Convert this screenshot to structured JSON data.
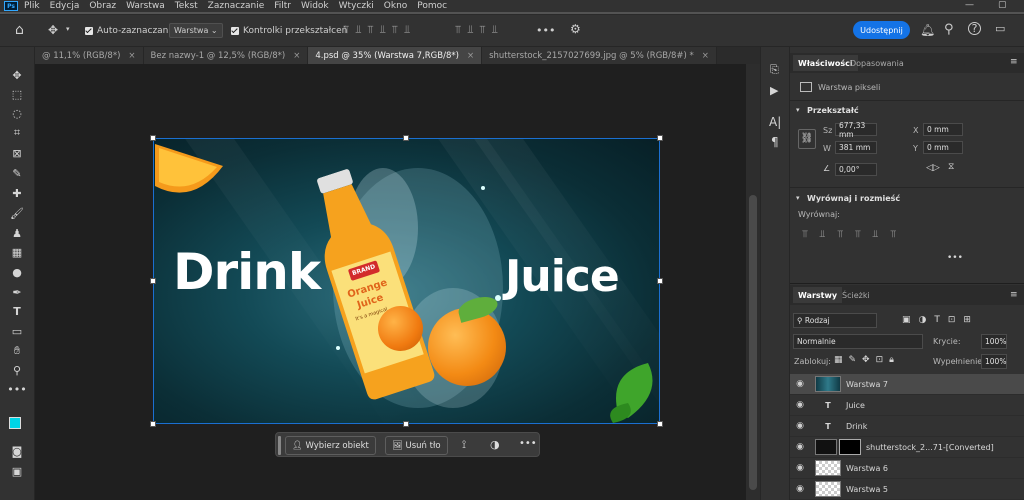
{
  "menubar": {
    "items": [
      "Plik",
      "Edycja",
      "Obraz",
      "Warstwa",
      "Tekst",
      "Zaznaczanie",
      "Filtr",
      "Widok",
      "Wtyczki",
      "Okno",
      "Pomoc"
    ]
  },
  "options": {
    "auto_select_label": "Auto-zaznaczanie:",
    "auto_select_value": "Warstwa",
    "transform_controls_label": "Kontrolki przekształceń",
    "share_label": "Udostępnij"
  },
  "tabs": [
    {
      "label": "@ 11,1% (RGB/8*)"
    },
    {
      "label": "Bez nazwy-1 @ 12,5% (RGB/8*)"
    },
    {
      "label": "4.psd @ 35% (Warstwa 7,RGB/8*)"
    },
    {
      "label": "shutterstock_2157027699.jpg @ 5% (RGB/8#) *"
    }
  ],
  "artwork": {
    "left_text": "Drink",
    "right_text": "Juice",
    "brand_label": "BRAND",
    "product_line1": "Orange",
    "product_line2": "Juice",
    "tagline": "It's a magical"
  },
  "context_bar": {
    "select_subject": "Wybierz obiekt",
    "remove_bg": "Usuń tło"
  },
  "properties": {
    "tab_properties": "Właściwości",
    "tab_adjustments": "Dopasowania",
    "layer_kind": "Warstwa pikseli",
    "transform_title": "Przekształć",
    "w_label": "Sz",
    "w_value": "677,33 mm",
    "h_label": "W",
    "h_value": "381 mm",
    "x_label": "X",
    "x_value": "0 mm",
    "y_label": "Y",
    "y_value": "0 mm",
    "angle_value": "0,00°",
    "align_title": "Wyrównaj i rozmieść",
    "align_label": "Wyrównaj:"
  },
  "layers_panel": {
    "tab_layers": "Warstwy",
    "tab_paths": "Ścieżki",
    "filter": "Rodzaj",
    "blend": "Normalnie",
    "opacity_label": "Krycie:",
    "opacity_value": "100%",
    "lock_label": "Zablokuj:",
    "fill_label": "Wypełnienie:",
    "fill_value": "100%",
    "layers": [
      {
        "name": "Warstwa 7",
        "type": "image",
        "selected": true
      },
      {
        "name": "Juice",
        "type": "text"
      },
      {
        "name": "Drink",
        "type": "text"
      },
      {
        "name": "shutterstock_2...71-[Converted]",
        "type": "smart"
      },
      {
        "name": "Warstwa 6",
        "type": "empty"
      },
      {
        "name": "Warstwa 5",
        "type": "empty"
      }
    ]
  },
  "colors": {
    "accent": "#1473e6",
    "foreground": "#00d4e6",
    "background": "#000000"
  }
}
